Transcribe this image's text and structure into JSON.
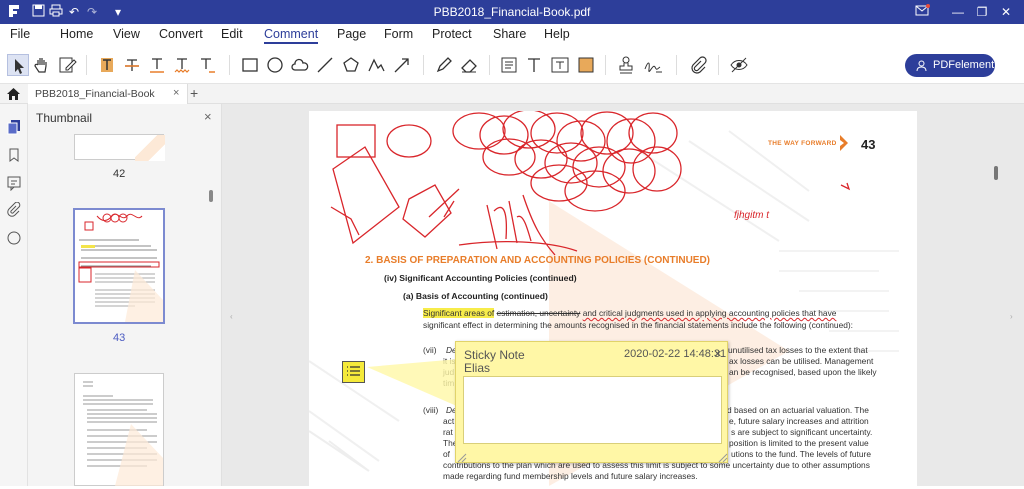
{
  "app": {
    "title": "PBB2018_Financial-Book.pdf"
  },
  "menu": [
    "File",
    "Home",
    "View",
    "Convert",
    "Edit",
    "Comment",
    "Page",
    "Form",
    "Protect",
    "Share",
    "Help"
  ],
  "brand_button": "PDFelement",
  "tab": {
    "label": "PBB2018_Financial-Book",
    "add": "+"
  },
  "thumbnails": {
    "title": "Thumbnail",
    "close": "×",
    "pages": [
      "42",
      "43"
    ]
  },
  "page": {
    "header": "THE WAY FORWARD",
    "number": "43",
    "handwriting": "fjhgitm t",
    "section": "2.   BASIS OF PREPARATION AND ACCOUNTING POLICIES (CONTINUED)",
    "sub_iv": "(iv)  Significant Accounting Policies (continued)",
    "sub_a": "(a)   Basis of Accounting (continued)",
    "para_highlight": "Significant areas of",
    "para_strike": "estimation, uncertainty",
    "para_rest": "and critical judgments used in applying accounting policies that have",
    "para_line2": "significant effect in determining the amounts recognised in the financial statements include the following (continued):",
    "vii_label": "(vii)",
    "vii_lead": "Def",
    "vii_l1": "unutilised tax losses to the extent that",
    "vii_l1b": "it is",
    "vii_l2": "ax losses can be utilised. Management",
    "vii_l2b": "jud",
    "vii_l3": "an be recognised, based upon the likely",
    "vii_l3b": "tim",
    "viii_label": "(viii)",
    "viii_lead": "Def",
    "viii_l1": "d based on an actuarial valuation. The",
    "viii_l1b": "act",
    "viii_l2": "e, future salary increases and attrition",
    "viii_l2b": "rat",
    "viii_l3": "s are subject to significant uncertainty.",
    "viii_l3b": "The",
    "viii_l4": "position is limited to the present value",
    "viii_l4b": "of",
    "viii_l5": "utions to the fund. The levels of future",
    "viii_l6": "contributions to the plan which are used to assess this limit is subject to some uncertainty due to other assumptions",
    "viii_l7": "made regarding fund membership levels and future salary increases."
  },
  "sticky_note": {
    "title": "Sticky Note",
    "author": "Elias",
    "date": "2020-02-22 14:48:31",
    "close": "×"
  },
  "colors": {
    "accent": "#2d3e9a",
    "orange": "#e87d2a",
    "ink": "#d9262b"
  }
}
